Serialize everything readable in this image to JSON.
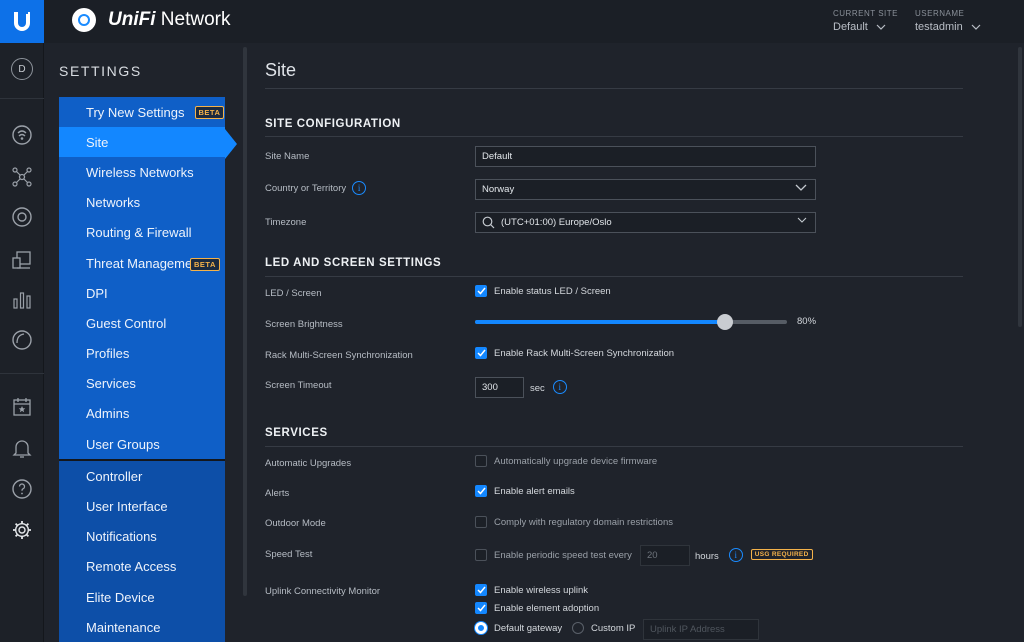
{
  "app": {
    "brand_logo": "UniFi",
    "brand_suffix": "Network"
  },
  "top": {
    "site_label": "CURRENT SITE",
    "site_value": "Default",
    "user_label": "USERNAME",
    "user_value": "testadmin"
  },
  "rail": {
    "avatar": "D"
  },
  "settings_title": "SETTINGS",
  "nav_group1": [
    {
      "label": "Try New Settings",
      "badge": "BETA"
    },
    {
      "label": "Site"
    },
    {
      "label": "Wireless Networks"
    },
    {
      "label": "Networks"
    },
    {
      "label": "Routing & Firewall"
    },
    {
      "label": "Threat Management",
      "badge": "BETA"
    },
    {
      "label": "DPI"
    },
    {
      "label": "Guest Control"
    },
    {
      "label": "Profiles"
    },
    {
      "label": "Services"
    },
    {
      "label": "Admins"
    },
    {
      "label": "User Groups"
    }
  ],
  "nav_group2": [
    {
      "label": "Controller"
    },
    {
      "label": "User Interface"
    },
    {
      "label": "Notifications"
    },
    {
      "label": "Remote Access"
    },
    {
      "label": "Elite Device"
    },
    {
      "label": "Maintenance"
    }
  ],
  "page": {
    "title": "Site",
    "site_config": {
      "heading": "SITE CONFIGURATION",
      "site_name_label": "Site Name",
      "site_name_value": "Default",
      "country_label": "Country or Territory",
      "country_value": "Norway",
      "timezone_label": "Timezone",
      "timezone_value": "(UTC+01:00) Europe/Oslo"
    },
    "led": {
      "heading": "LED AND SCREEN SETTINGS",
      "led_label": "LED / Screen",
      "led_check": "Enable status LED / Screen",
      "led_checked": true,
      "brightness_label": "Screen Brightness",
      "brightness_value": 80,
      "brightness_text": "80%",
      "rack_label": "Rack Multi-Screen Synchronization",
      "rack_check": "Enable Rack Multi-Screen Synchronization",
      "timeout_label": "Screen Timeout",
      "timeout_value": "300",
      "timeout_unit": "sec"
    },
    "services": {
      "heading": "SERVICES",
      "auto_label": "Automatic Upgrades",
      "auto_check": "Automatically upgrade device firmware",
      "alerts_label": "Alerts",
      "alerts_check": "Enable alert emails",
      "outdoor_label": "Outdoor Mode",
      "outdoor_check": "Comply with regulatory domain restrictions",
      "speed_label": "Speed Test",
      "speed_check": "Enable periodic speed test every",
      "speed_value": "20",
      "speed_unit": "hours",
      "usg_badge": "USG REQUIRED",
      "uplink_label": "Uplink Connectivity Monitor",
      "uplink_check1": "Enable wireless uplink",
      "uplink_check2": "Enable element adoption",
      "radio_default": "Default gateway",
      "radio_custom": "Custom IP",
      "uplink_placeholder": "Uplink IP Address"
    }
  },
  "colors": {
    "accent": "#1387ff",
    "nav_blue": "#0f5fc7",
    "warning": "#f4b24a"
  }
}
